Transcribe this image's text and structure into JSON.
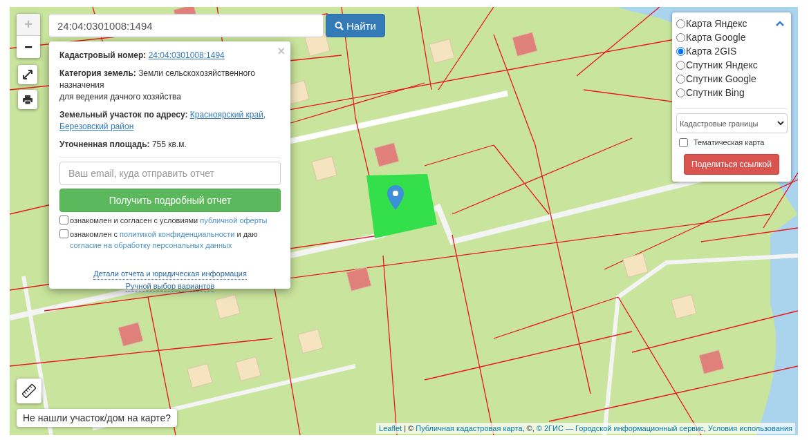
{
  "search": {
    "value": "24:04:0301008:1494",
    "button": "Найти"
  },
  "zoom": {
    "zoom_in": "+",
    "zoom_out": "−"
  },
  "popup": {
    "close": "×",
    "fields": [
      {
        "label": "Кадастровый номер:",
        "kind": "link",
        "lines": [
          "24:04:0301008:1494"
        ]
      },
      {
        "label": "Категория земель:",
        "kind": "text",
        "lines": [
          "Земли сельскохозяйственного назначения",
          "для ведения дачного хозяйства"
        ]
      },
      {
        "label": "Земельный участок по адресу:",
        "kind": "link",
        "lines": [
          "Красноярский край,",
          "Березовский район"
        ]
      },
      {
        "label": "Уточненная площадь:",
        "kind": "text",
        "lines": [
          "755 кв.м."
        ]
      }
    ],
    "email": {
      "placeholder": "Ваш email, куда отправить отчет"
    },
    "submit": "Получить подробный отчет",
    "agreements": [
      {
        "checked": false,
        "parts": [
          {
            "text": "ознакомлен и согласен с условиями ",
            "kind": "text"
          },
          {
            "text": "публичной оферты",
            "kind": "link"
          }
        ]
      },
      {
        "checked": false,
        "parts": [
          {
            "text": "ознакомлен с ",
            "kind": "text"
          },
          {
            "text": "политикой конфиденциальности",
            "kind": "link"
          },
          {
            "text": " и даю ",
            "kind": "text"
          },
          {
            "text": "согласие на обработку персональных данных",
            "kind": "link"
          }
        ]
      }
    ],
    "links": [
      "Детали отчета и юридическая информация",
      "Ручной выбор вариантов"
    ]
  },
  "layers": {
    "options": [
      {
        "label": "Карта Яндекс",
        "selected": false
      },
      {
        "label": "Карта Google",
        "selected": false
      },
      {
        "label": "Карта 2GIS",
        "selected": true
      },
      {
        "label": "Спутник Яндекс",
        "selected": false
      },
      {
        "label": "Спутник Google",
        "selected": false
      },
      {
        "label": "Спутник Bing",
        "selected": false
      }
    ],
    "overlay_select": "Кадастровые границы",
    "thematic": {
      "label": "Тематическая карта",
      "checked": false
    },
    "share": "Поделиться ссылкой"
  },
  "not_found_button": "Не нашли участок/дом на карте?",
  "attribution": [
    {
      "text": "Leaflet",
      "kind": "link"
    },
    {
      "text": " | © ",
      "kind": "text"
    },
    {
      "text": "Публичная кадастровая карта",
      "kind": "link"
    },
    {
      "text": ", ©, ",
      "kind": "text"
    },
    {
      "text": "© 2ГИС — Городской информационный сервис",
      "kind": "link"
    },
    {
      "text": ", ",
      "kind": "text"
    },
    {
      "text": "Условия использования",
      "kind": "link"
    }
  ]
}
